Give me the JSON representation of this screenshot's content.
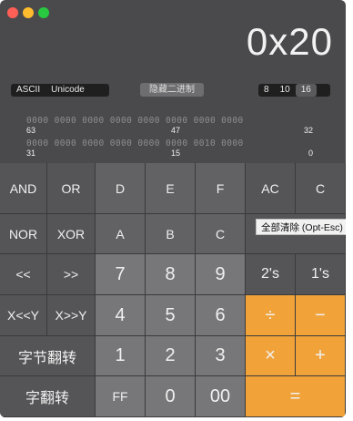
{
  "window": {
    "traffic_lights": [
      "close",
      "minimize",
      "zoom"
    ]
  },
  "display": {
    "value": "0x20"
  },
  "encoding": {
    "options": [
      "ASCII",
      "Unicode"
    ]
  },
  "hide_binary_button": "隐藏二进制",
  "base": {
    "options": [
      "8",
      "10",
      "16"
    ],
    "selected": "16"
  },
  "bits": {
    "row1": "0000 0000 0000 0000 0000 0000 0000 0000",
    "row1_labels": [
      "63",
      "47",
      "32"
    ],
    "row2": "0000 0000 0000 0000 0000 0000 0010 0000",
    "row2_labels": [
      "31",
      "15",
      "0"
    ]
  },
  "keys": {
    "and": "AND",
    "or": "OR",
    "d": "D",
    "e": "E",
    "f": "F",
    "ac": "AC",
    "c": "C",
    "nor": "NOR",
    "xor": "XOR",
    "a": "A",
    "b": "B",
    "c_hex": "C",
    "shl": "<<",
    "shr": ">>",
    "seven": "7",
    "eight": "8",
    "nine": "9",
    "twos": "2's",
    "ones": "1's",
    "rotl": "X<<Y",
    "rotr": "X>>Y",
    "four": "4",
    "five": "5",
    "six": "6",
    "divide": "÷",
    "minus": "−",
    "byte_flip": "字节翻转",
    "one": "1",
    "two": "2",
    "three": "3",
    "multiply": "×",
    "plus": "+",
    "word_flip": "字翻转",
    "ff": "FF",
    "zero": "0",
    "double_zero": "00",
    "equals": "="
  },
  "tooltip": "全部清除 (Opt-Esc)",
  "colors": {
    "orange": "#f1a33a",
    "body": "#4a4a4c"
  }
}
